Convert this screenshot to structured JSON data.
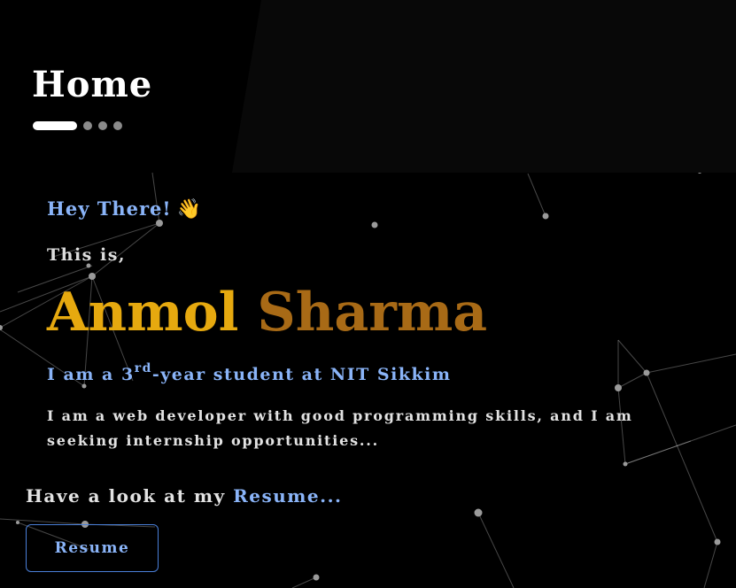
{
  "header": {
    "title": "Home",
    "pager": {
      "total": 4,
      "active_index": 0
    }
  },
  "hero": {
    "greeting": "Hey There!",
    "wave_icon": "👋",
    "intro_prefix": "This is,",
    "first_name": "Anmol",
    "last_name": "Sharma",
    "tagline_before": "I am a 3",
    "tagline_sup": "rd",
    "tagline_after": "-year student at NIT Sikkim",
    "description": "I am a web developer with good programming skills, and I am seeking internship opportunities..."
  },
  "resume": {
    "prompt_text": "Have a look at my ",
    "prompt_link": "Resume...",
    "button_label": "Resume"
  },
  "colors": {
    "background": "#000000",
    "accent_blue": "#8ab4f8",
    "first_name": "#e6a90f",
    "last_name": "#a86a16"
  }
}
